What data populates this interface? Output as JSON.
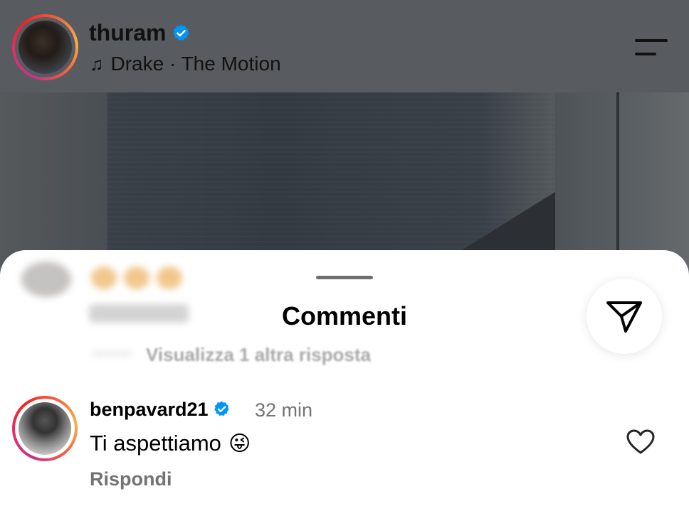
{
  "header": {
    "username": "thuram",
    "music": "Drake · The Motion",
    "music_icon": "♫"
  },
  "sheet": {
    "title": "Commenti",
    "view_more": "Visualizza 1 altra risposta",
    "blurred_reply": "Rispondi"
  },
  "comment": {
    "username": "benpavard21",
    "time": "32 min",
    "text": "Ti aspettiamo",
    "emoji": "😜",
    "reply": "Rispondi"
  },
  "colors": {
    "verified": "#0095f6",
    "secondary_text": "#737373",
    "ring_start": "#c13584",
    "ring_end": "#fcaf45"
  },
  "icons": [
    "music-note-icon",
    "verified-badge-icon",
    "menu-icon",
    "share-send-icon",
    "heart-icon"
  ]
}
